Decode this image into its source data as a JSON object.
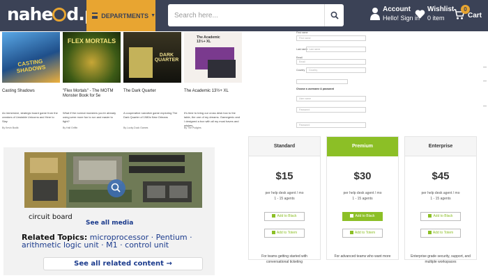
{
  "header": {
    "logo_left": "nahe",
    "logo_right": "d.pk",
    "departments_label": "DEPARTMENTS",
    "search_placeholder": "Search here...",
    "account_title": "Account",
    "account_sub": "Hello! Sign in",
    "wishlist_title": "Wishlist",
    "wishlist_sub": "0 item",
    "cart_label": "Cart",
    "cart_count": "0"
  },
  "books": [
    {
      "title": "Casting Shadows",
      "cover_text": "CASTING SHADOWS",
      "desc": "An immersive, strategic board game from the creators of Unstable Unicorns and Here to Slay",
      "author": "By Kevin Bodik",
      "cover_color": "#2a6aa8"
    },
    {
      "title": "\"Flex Mortals\" - The MOTM Monster Book for 5e",
      "cover_text": "FLEX MORTALS",
      "desc": "What if the normal monsters you're already using were more fun to run and easier to fight?",
      "author": "By Hall Griffin",
      "cover_color": "#4a6a1e"
    },
    {
      "title": "The Dark Quarter",
      "cover_text": "DARK QUARTER",
      "desc": "A cooperative narrative game exploring The Dark Quarter of 1980s New Orleans",
      "author": "By Lucky Duck Games",
      "cover_color": "#1c1c16"
    },
    {
      "title": "The Academic 13½+ XL",
      "cover_text": "The Academic 13½+ XL",
      "desc": "It's time to bring our cross desk box to the table, the one of my dreams. Gamegenic and I designed a box with all my must haves and wishes.",
      "author": "By The Pudgies",
      "cover_color": "#7a3a8e"
    }
  ],
  "form": {
    "l1": "First name",
    "p1": "First name",
    "l2": "Last name",
    "p2": "Last name",
    "l3": "Email",
    "p3": "Email",
    "l4": "Country",
    "p4": "Country",
    "l5": "Choose a username & password",
    "p5": "User name",
    "p6": "Password",
    "p7": "Password"
  },
  "media": {
    "caption": "circuit board",
    "see_all": "See all media",
    "related_label": "Related Topics:",
    "related_topics": "microprocessor · Pentium · arithmetic logic unit · M1 · control unit",
    "see_related": "See all related content →"
  },
  "pricing": {
    "plans": [
      {
        "name": "Standard",
        "price": "$15",
        "note1": "per help desk agent / mo",
        "note2": "1 - 15 agents",
        "btn1": "Add to Black",
        "btn2": "Add to Totem",
        "footer": "For teams getting started with conversational ticketing"
      },
      {
        "name": "Premium",
        "price": "$30",
        "note1": "per help desk agent / mo",
        "note2": "1 - 15 agents",
        "btn1": "Add to Black",
        "btn2": "Add to Totem",
        "footer": "For advanced teams who want more"
      },
      {
        "name": "Enterprise",
        "price": "$45",
        "note1": "per help desk agent / mo",
        "note2": "1 - 15 agents",
        "btn1": "Add to Black",
        "btn2": "Add to Totem",
        "footer": "Enterprise grade security, support, and multiple workspaces"
      }
    ]
  },
  "colors": {
    "header_bg": "#3b4256",
    "accent": "#e8a531",
    "plan_accent": "#8cbf26",
    "link": "#1a3a8c"
  }
}
